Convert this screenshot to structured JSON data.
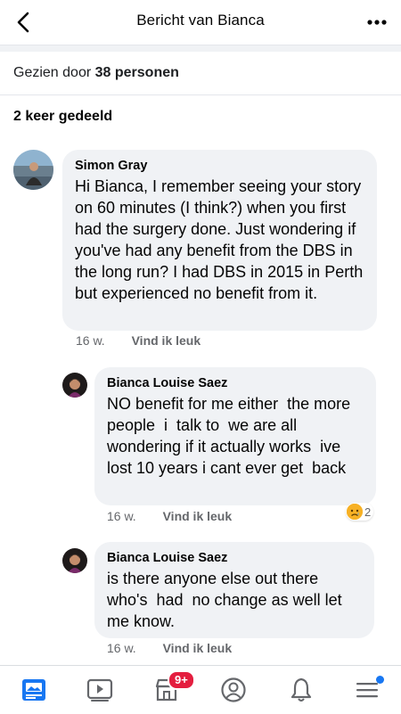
{
  "header": {
    "title": "Bericht van Bianca"
  },
  "seen": {
    "prefix": "Gezien door",
    "count": "38 personen"
  },
  "shared": {
    "label": "2 keer gedeeld"
  },
  "comments": [
    {
      "author": "Simon Gray",
      "text": "Hi Bianca, I remember seeing your story on 60 minutes (I think?) when you first had the surgery done. Just wondering if you've had any benefit from the DBS in the long run? I had DBS in 2015 in Perth but experienced no benefit from it.",
      "time": "16 w.",
      "like": "Vind ik leuk"
    },
    {
      "author": "Bianca Louise Saez",
      "text": "NO benefit for me either  the more  people  i  talk to  we are all wondering if it actually works  ive lost 10 years i cant ever get  back",
      "time": "16 w.",
      "like": "Vind ik leuk",
      "reaction_count": "2",
      "reaction_icon": "sad-emoji-icon"
    },
    {
      "author": "Bianca Louise Saez",
      "text": "is there anyone else out there who's  had  no change as well let me know.",
      "time": "16 w.",
      "like": "Vind ik leuk"
    }
  ],
  "tabbar": {
    "tabs": [
      "news-feed-icon",
      "watch-icon",
      "marketplace-icon",
      "profile-icon",
      "notifications-icon",
      "menu-icon"
    ],
    "marketplace_badge": "9+"
  },
  "colors": {
    "accent": "#1877f2",
    "badge": "#e41e3f",
    "bubble": "#f0f2f5"
  }
}
